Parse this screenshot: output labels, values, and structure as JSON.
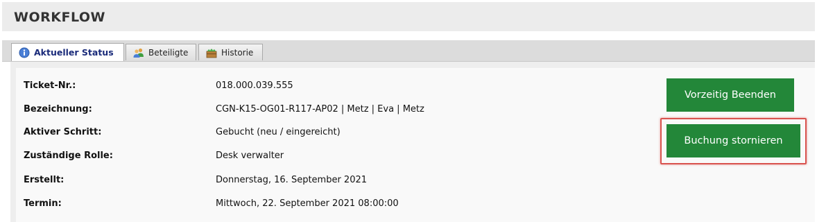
{
  "header": {
    "title": "WORKFLOW"
  },
  "tabs": [
    {
      "label": "Aktueller Status",
      "icon": "info-icon"
    },
    {
      "label": "Beteiligte",
      "icon": "users-icon"
    },
    {
      "label": "Historie",
      "icon": "history-icon"
    }
  ],
  "details": [
    {
      "label": "Ticket-Nr.:",
      "value": "018.000.039.555"
    },
    {
      "label": "Bezeichnung:",
      "value": "CGN-K15-OG01-R117-AP02 | Metz | Eva | Metz"
    },
    {
      "label": "Aktiver Schritt:",
      "value": "Gebucht (neu / eingereicht)"
    },
    {
      "label": "Zuständige Rolle:",
      "value": "Desk verwalter"
    },
    {
      "label": "Erstellt:",
      "value": "Donnerstag, 16. September 2021"
    },
    {
      "label": "Termin:",
      "value": "Mittwoch, 22. September 2021 08:00:00"
    }
  ],
  "actions": {
    "end_early_label": "Vorzeitig Beenden",
    "cancel_booking_label": "Buchung stornieren"
  },
  "colors": {
    "button_green": "#238739",
    "highlight_red": "#d9534f",
    "active_tab_text": "#1a2b7a"
  }
}
